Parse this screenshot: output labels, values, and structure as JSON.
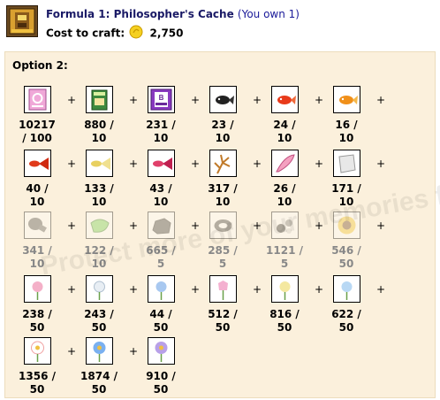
{
  "header": {
    "icon": "philosophers-cache-icon",
    "title": "Formula 1: Philosopher's Cache",
    "ownership": "(You own 1)",
    "cost_label": "Cost to craft:",
    "cost_icon": "gold-coin-icon",
    "cost_value": "2,750"
  },
  "option": {
    "label": "Option 2:",
    "rows": [
      [
        {
          "icon": "pink-g-card-icon",
          "qty": "10217 / 100",
          "faded": false
        },
        {
          "icon": "green-bag-icon",
          "qty": "880 / 10",
          "faded": false
        },
        {
          "icon": "purple-b-credit-icon",
          "qty": "231 / 10",
          "faded": false
        },
        {
          "icon": "black-goldfish-icon",
          "qty": "23 / 10",
          "faded": false
        },
        {
          "icon": "red-goldfish-icon",
          "qty": "24 / 10",
          "faded": false
        },
        {
          "icon": "orange-goldfish-icon",
          "qty": "16 / 10",
          "faded": false
        }
      ],
      [
        {
          "icon": "red-guppy-icon",
          "qty": "40 / 10",
          "faded": false
        },
        {
          "icon": "yellow-guppy-icon",
          "qty": "133 / 10",
          "faded": false
        },
        {
          "icon": "pink-guppy-icon",
          "qty": "43 / 10",
          "faded": false
        },
        {
          "icon": "coral-branch-icon",
          "qty": "317 / 10",
          "faded": false
        },
        {
          "icon": "pink-feather-icon",
          "qty": "26 / 10",
          "faded": false
        },
        {
          "icon": "white-cloth-icon",
          "qty": "171 / 10",
          "faded": false
        }
      ],
      [
        {
          "icon": "mushroom-icon",
          "qty": "341 / 10",
          "faded": true
        },
        {
          "icon": "green-slime-icon",
          "qty": "122 / 10",
          "faded": true
        },
        {
          "icon": "dark-rock-icon",
          "qty": "665 / 5",
          "faded": true
        },
        {
          "icon": "tire-ring-icon",
          "qty": "285 / 5",
          "faded": true
        },
        {
          "icon": "coal-stones-icon",
          "qty": "1121 / 5",
          "faded": true
        },
        {
          "icon": "sunflower-icon",
          "qty": "546 / 50",
          "faded": true
        }
      ],
      [
        {
          "icon": "pink-rose-icon",
          "qty": "238 / 50",
          "faded": false
        },
        {
          "icon": "white-flower-icon",
          "qty": "243 / 50",
          "faded": false
        },
        {
          "icon": "blue-flower-icon",
          "qty": "44",
          "total": " / 50",
          "short": true,
          "faded": false
        },
        {
          "icon": "pink-tulip-icon",
          "qty": "512 / 50",
          "faded": false
        },
        {
          "icon": "yellow-flower-icon",
          "qty": "816 / 50",
          "faded": false
        },
        {
          "icon": "light-blue-flower-icon",
          "qty": "622 / 50",
          "faded": false
        }
      ],
      [
        {
          "icon": "daisy-icon",
          "qty": "1356 / 50",
          "faded": false
        },
        {
          "icon": "blue-daisy-icon",
          "qty": "1874 / 50",
          "faded": false
        },
        {
          "icon": "purple-daisy-icon",
          "qty": "910 / 50",
          "faded": false
        }
      ]
    ]
  },
  "colors": {
    "panel_bg": "#fbf0dc",
    "title": "#1a1a66",
    "short_qty": "#cc0000"
  },
  "watermark": {
    "text": "Protect more of your memories for less!"
  }
}
